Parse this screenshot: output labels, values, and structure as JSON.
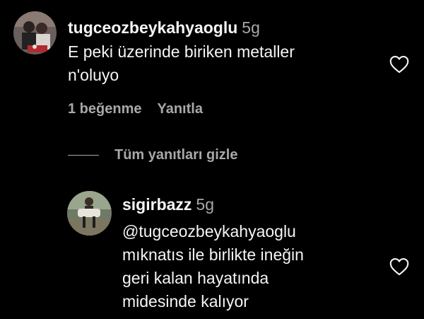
{
  "comment": {
    "username": "tugceozbeykahyaoglu",
    "age": "5g",
    "text": "E peki üzerinde biriken metaller\nn'oluyo",
    "likes_label": "1 beğenme",
    "reply_label": "Yanıtla",
    "avatar_icon": "profile-photo-icon",
    "heart_icon": "heart-outline-icon"
  },
  "hide_replies": {
    "label": "Tüm yanıtları gizle"
  },
  "reply": {
    "username": "sigirbazz",
    "age": "5g",
    "text": "@tugceozbeykahyaoglu\nmıknatıs ile birlikte ineğin\ngeri kalan hayatında\nmidesinde kalıyor",
    "avatar_icon": "profile-photo-icon",
    "heart_icon": "heart-outline-icon"
  },
  "colors": {
    "background": "#000000",
    "primary_text": "#f5f5f5",
    "secondary_text": "#a8a8a8"
  }
}
